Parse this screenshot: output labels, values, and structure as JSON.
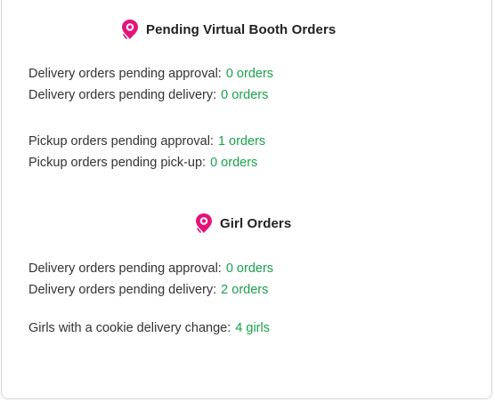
{
  "virtual_booth": {
    "title": "Pending Virtual Booth Orders",
    "icon": "map-pin-icon",
    "rows": [
      {
        "label": "Delivery orders pending approval:",
        "value": "0 orders"
      },
      {
        "label": "Delivery orders pending delivery:",
        "value": "0 orders"
      },
      {
        "label": "Pickup orders pending approval:",
        "value": "1 orders"
      },
      {
        "label": "Pickup orders pending pick-up:",
        "value": "0 orders"
      }
    ]
  },
  "girl_orders": {
    "title": "Girl Orders",
    "icon": "map-pin-icon",
    "rows": [
      {
        "label": "Delivery orders pending approval:",
        "value": "0 orders"
      },
      {
        "label": "Delivery orders pending delivery:",
        "value": "2 orders"
      },
      {
        "label": "Girls with a cookie delivery change:",
        "value": "4 girls"
      }
    ]
  },
  "colors": {
    "accent_icon": "#e6127a",
    "value_green": "#1aa34a"
  }
}
